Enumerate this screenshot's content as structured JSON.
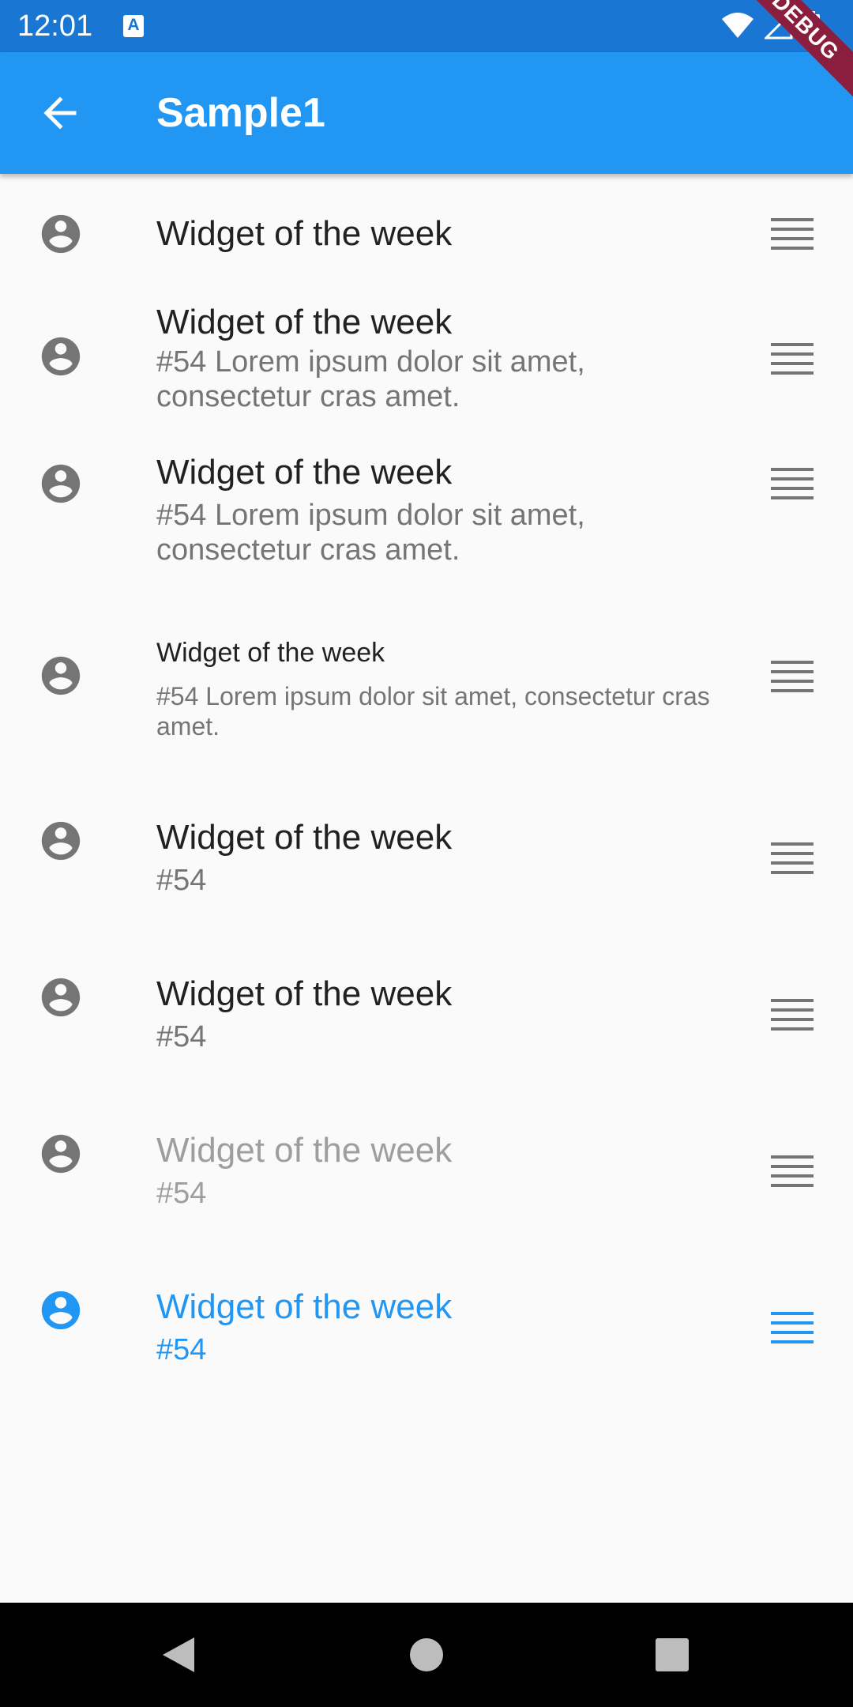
{
  "status_bar": {
    "time": "12:01",
    "a_icon": "A"
  },
  "debug_banner": "DEBUG",
  "app_bar": {
    "title": "Sample1",
    "back_icon": "arrow-back-icon"
  },
  "colors": {
    "primary": "#2196f3",
    "status_bar": "#1976d2",
    "text": "#212121",
    "secondary_text": "#757575",
    "disabled_text": "#9e9e9e",
    "icon": "#757575",
    "background": "#fafafa",
    "nav_bar": "#000000"
  },
  "list": [
    {
      "title": "Widget of the week",
      "subtitle": "",
      "state": "normal",
      "leading_icon": "account-circle-icon",
      "trailing_icon": "drag-handle-icon"
    },
    {
      "title": "Widget of the week",
      "subtitle": "#54 Lorem ipsum dolor sit amet, consectetur cras amet.",
      "state": "normal",
      "leading_icon": "account-circle-icon",
      "trailing_icon": "drag-handle-icon"
    },
    {
      "title": "Widget of the week",
      "subtitle": "#54 Lorem ipsum dolor sit amet, consectetur cras amet.",
      "state": "normal",
      "leading_icon": "account-circle-icon",
      "trailing_icon": "drag-handle-icon"
    },
    {
      "title": "Widget of the week",
      "subtitle": "#54 Lorem ipsum dolor sit amet, consectetur cras amet.",
      "state": "dense",
      "leading_icon": "account-circle-icon",
      "trailing_icon": "drag-handle-icon"
    },
    {
      "title": "Widget of the week",
      "subtitle": "#54",
      "state": "normal",
      "leading_icon": "account-circle-icon",
      "trailing_icon": "drag-handle-icon"
    },
    {
      "title": "Widget of the week",
      "subtitle": "#54",
      "state": "normal",
      "leading_icon": "account-circle-icon",
      "trailing_icon": "drag-handle-icon"
    },
    {
      "title": "Widget of the week",
      "subtitle": "#54",
      "state": "disabled",
      "leading_icon": "account-circle-icon",
      "trailing_icon": "drag-handle-icon"
    },
    {
      "title": "Widget of the week",
      "subtitle": "#54",
      "state": "selected",
      "leading_icon": "account-circle-icon",
      "trailing_icon": "drag-handle-icon"
    }
  ],
  "nav_bar": {
    "back_icon": "nav-back-icon",
    "home_icon": "nav-home-icon",
    "recents_icon": "nav-recents-icon"
  }
}
